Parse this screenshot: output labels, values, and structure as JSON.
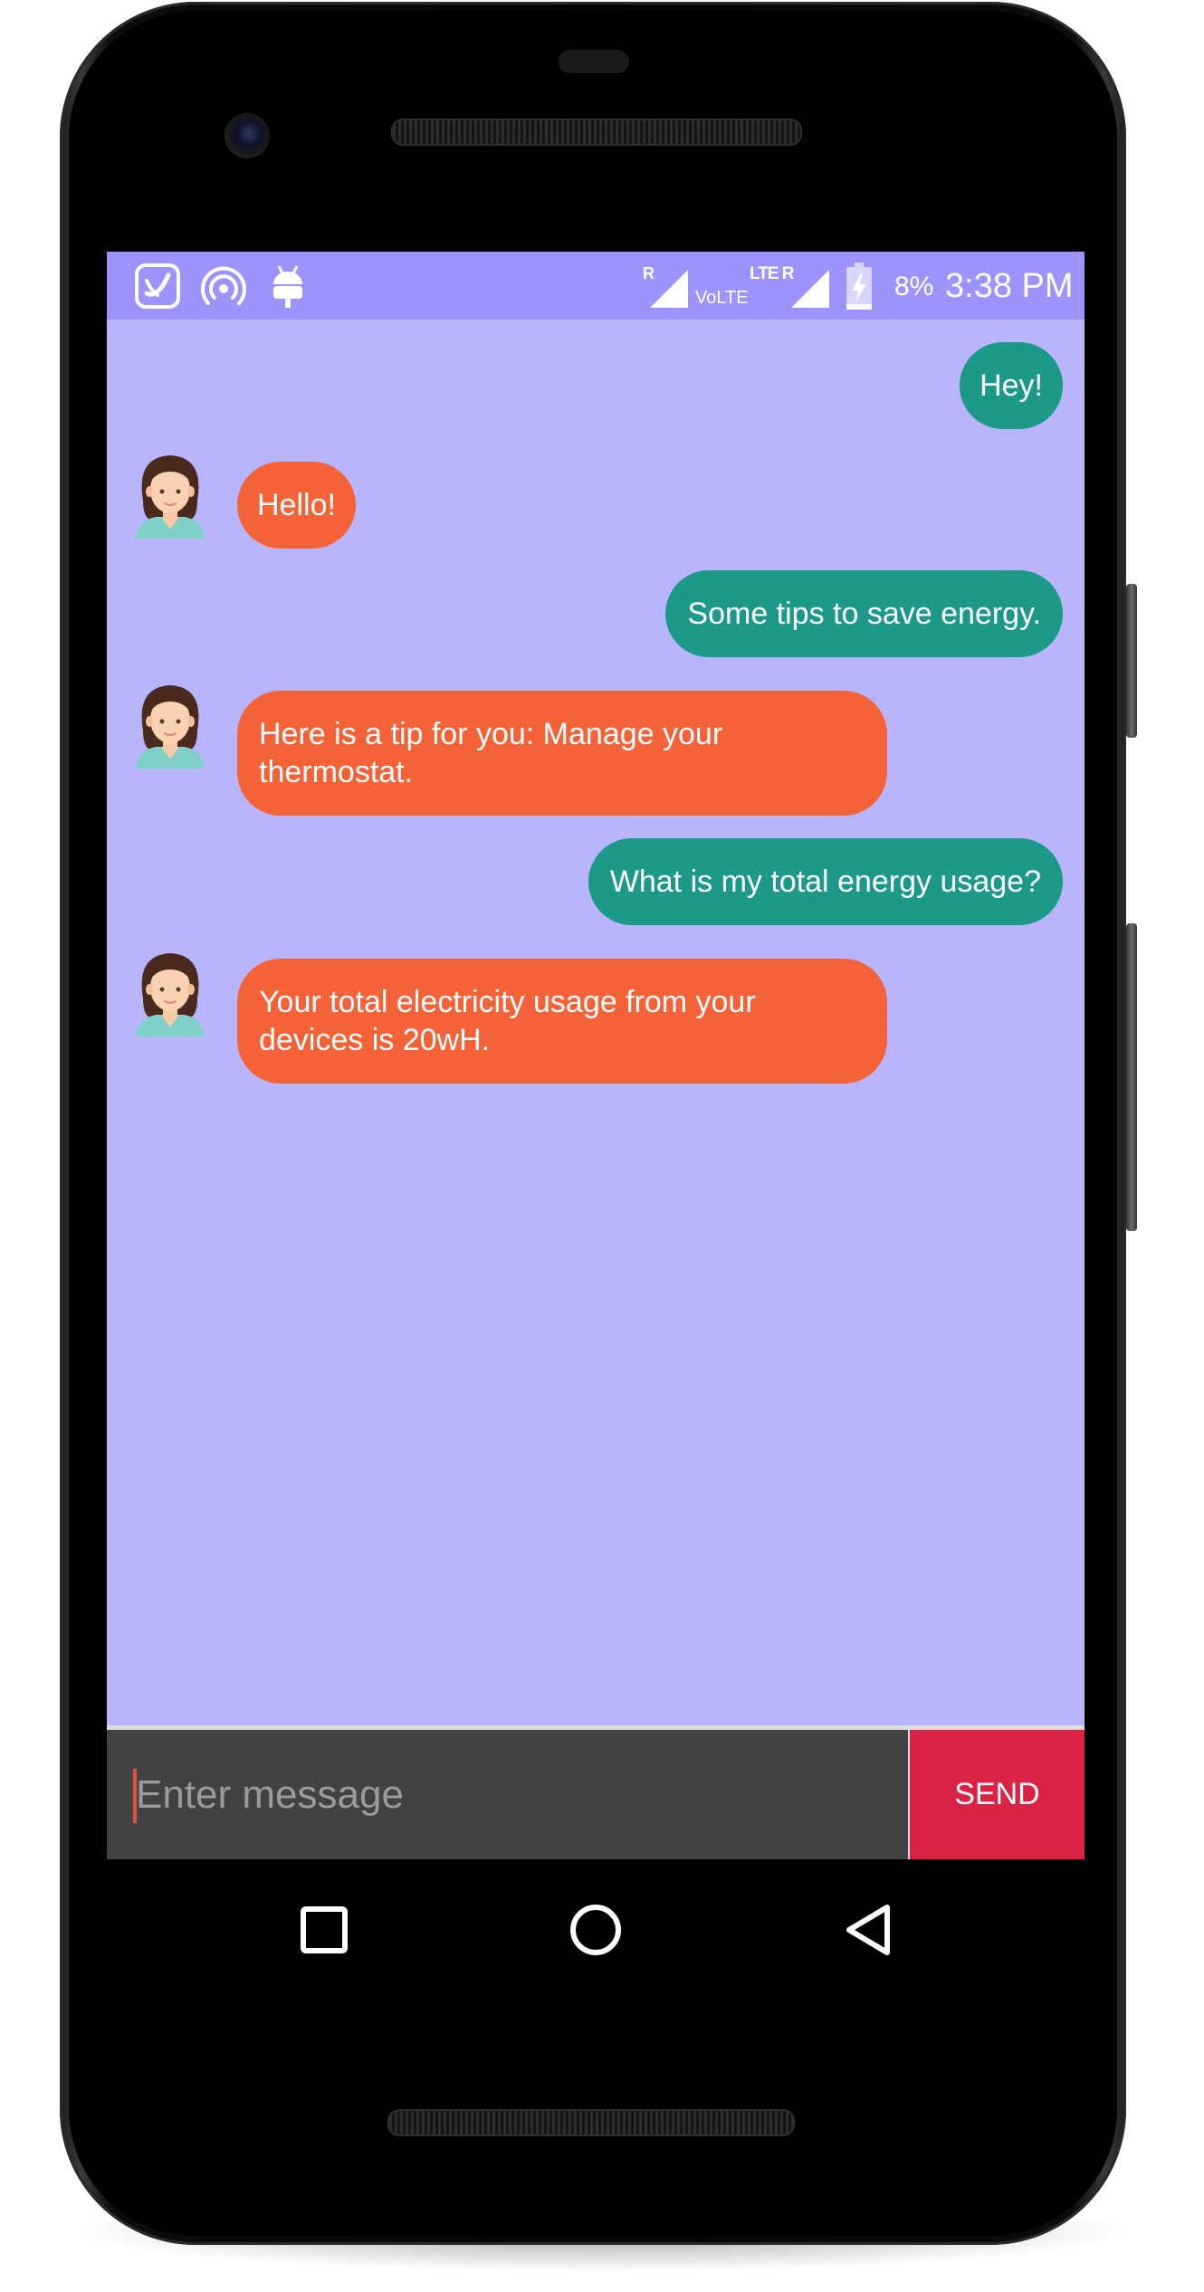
{
  "status_bar": {
    "battery": "8%",
    "time": "3:38 PM",
    "roaming_1": "R",
    "volte": "VoLTE",
    "lte_roaming": "LTE R"
  },
  "chat": {
    "messages": [
      {
        "from": "user",
        "text": "Hey!"
      },
      {
        "from": "bot",
        "text": "Hello!"
      },
      {
        "from": "user",
        "text": "Some tips to save energy."
      },
      {
        "from": "bot",
        "text": "Here is a tip for you: Manage your thermostat."
      },
      {
        "from": "user",
        "text": "What is my total energy usage?"
      },
      {
        "from": "bot",
        "text": "Your total electricity usage from your devices is 20wH."
      }
    ]
  },
  "composer": {
    "placeholder": "Enter message",
    "value": "",
    "send_label": "SEND"
  },
  "colors": {
    "chat_background": "#b9b5fd",
    "status_bar": "#9c94fc",
    "user_bubble": "#1c9a87",
    "bot_bubble": "#f46238",
    "send_button": "#d92244",
    "input_bar": "#424242"
  },
  "icons": {
    "status_left": [
      "saavn-icon",
      "hotspot-icon",
      "android-debug-icon"
    ],
    "status_right": [
      "signal-icon",
      "signal-icon",
      "battery-charging-icon"
    ],
    "nav": [
      "recents-icon",
      "home-icon",
      "back-icon"
    ]
  }
}
